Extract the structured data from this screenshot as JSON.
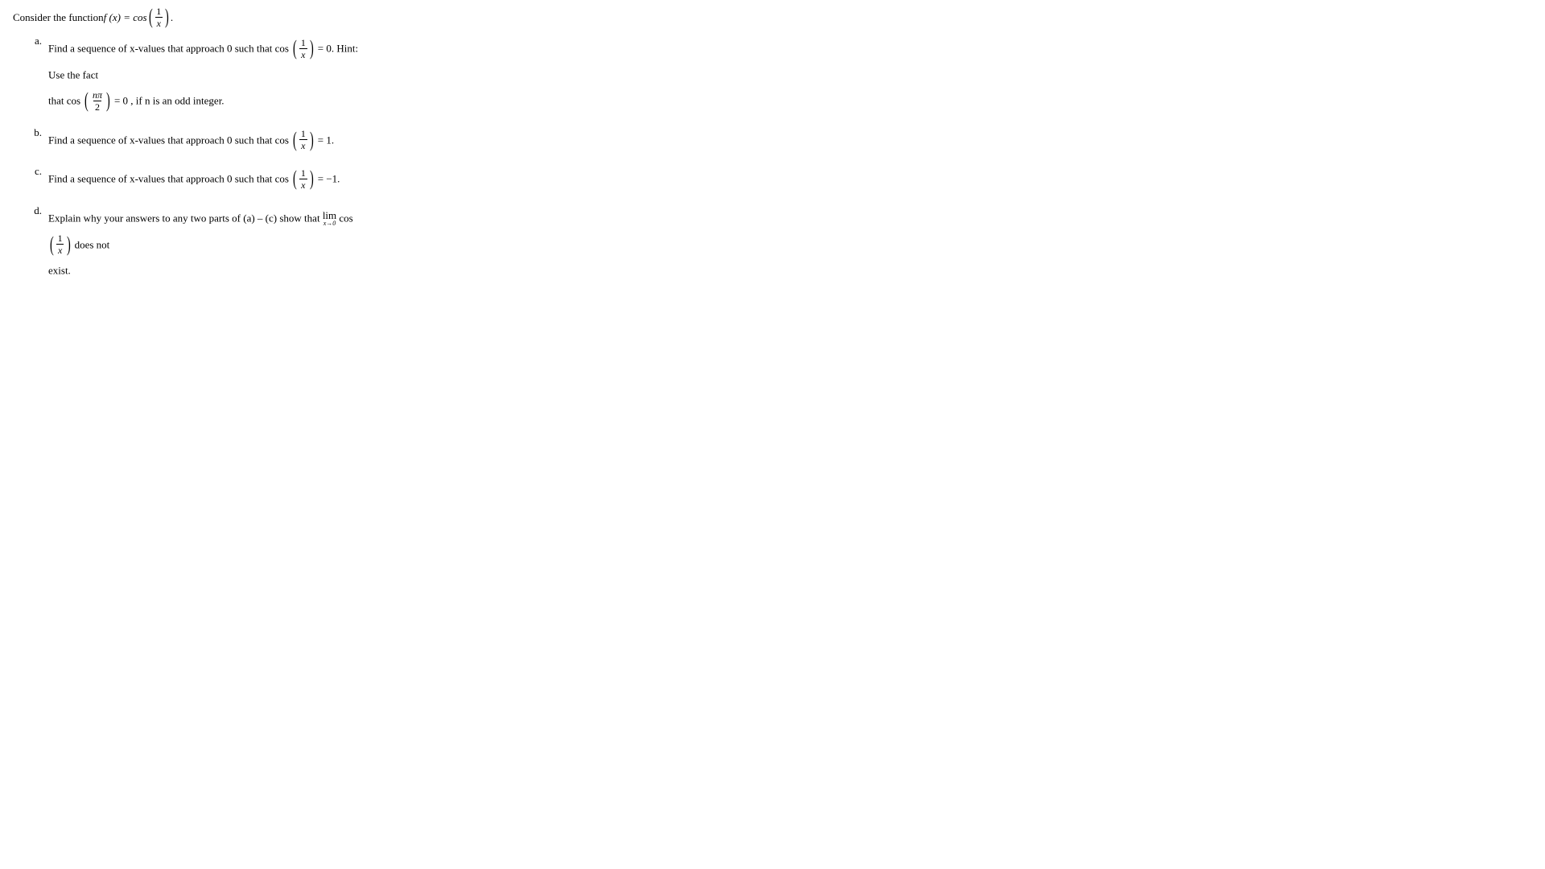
{
  "intro": {
    "prefix": "Consider the function  ",
    "fx": "f (x) = cos",
    "frac_num": "1",
    "frac_den": "x",
    "suffix": "."
  },
  "items": {
    "a": {
      "marker": "a.",
      "t1": "Find a sequence of x-values that approach 0 such that ",
      "cos1": "cos",
      "eq0": " = 0.",
      "hint": "   Hint: Use the fact",
      "t2": "that ",
      "cos2": "cos",
      "npi": "nπ",
      "two": "2",
      "eq0b": " = 0",
      "t3": ", if n is an odd integer."
    },
    "b": {
      "marker": "b.",
      "t1": "Find a sequence of x-values that approach 0 such that ",
      "cos": "cos",
      "eq": " = 1."
    },
    "c": {
      "marker": "c.",
      "t1": "Find a sequence of x-values that approach 0 such that ",
      "cos": "cos",
      "eq": " = −1."
    },
    "d": {
      "marker": "d.",
      "t1": "Explain why your answers to any two parts of (a) – (c) show that ",
      "lim": "lim",
      "limsub": "x→0",
      "cos": " cos",
      "t2": " does not",
      "t3": "exist."
    }
  },
  "one": "1",
  "x": "x"
}
